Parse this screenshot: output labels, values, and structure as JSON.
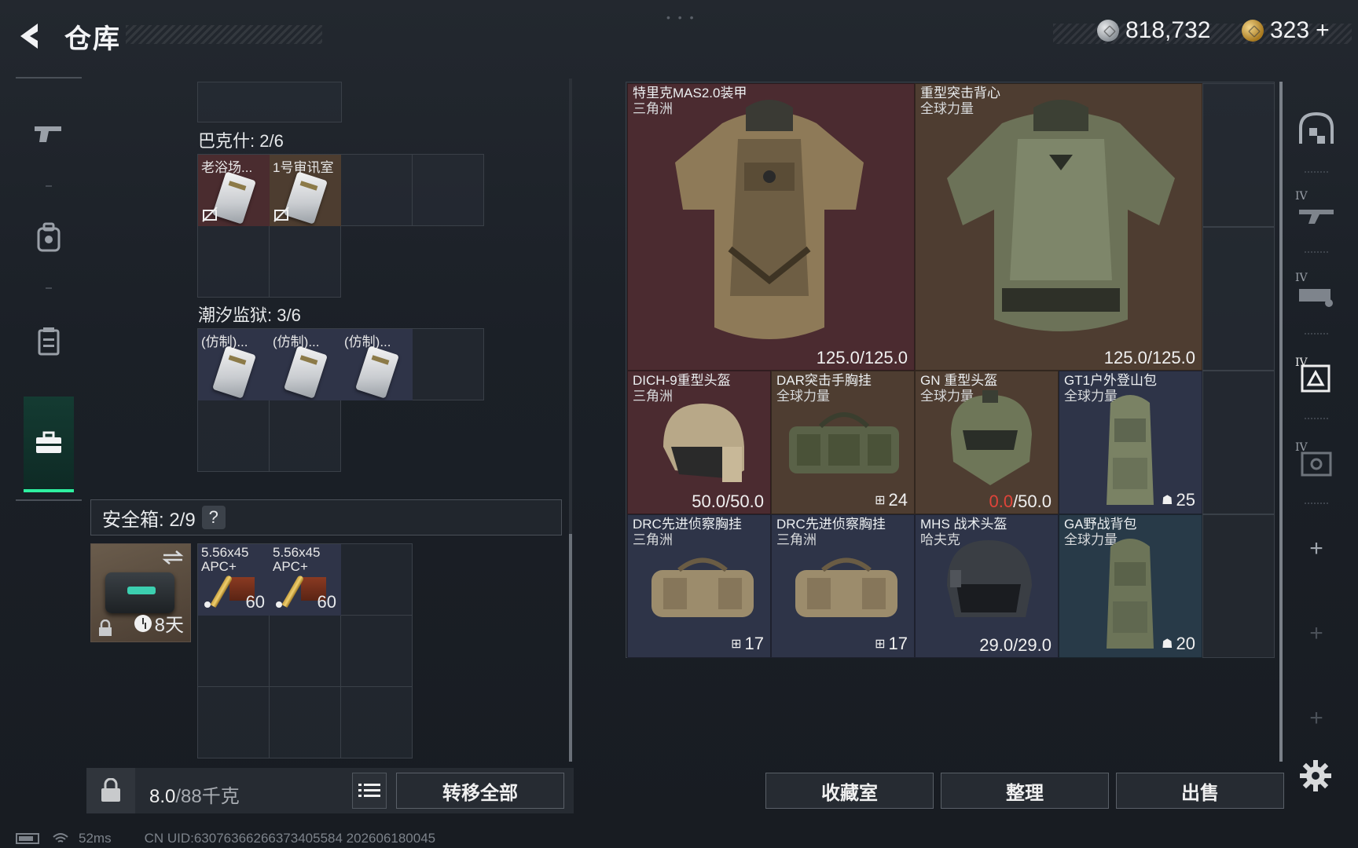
{
  "header": {
    "title": "仓库",
    "currency_silver": "818,732",
    "currency_gold": "323",
    "gold_plus": "+"
  },
  "left_nav": {
    "items": [
      {
        "name": "weapons",
        "icon": "pistol-icon"
      },
      {
        "name": "equipment",
        "icon": "backpack-icon"
      },
      {
        "name": "consumables",
        "icon": "container-icon"
      },
      {
        "name": "keys",
        "icon": "briefcase-icon",
        "active": true
      }
    ]
  },
  "key_groups": [
    {
      "label": "巴克什: 2/6",
      "items": [
        {
          "name": "老浴场..."
        },
        {
          "name": "1号审讯室"
        }
      ]
    },
    {
      "label": "潮汐监狱: 3/6",
      "items": [
        {
          "name": "(仿制)..."
        },
        {
          "name": "(仿制)..."
        },
        {
          "name": "(仿制)..."
        }
      ]
    }
  ],
  "safe_box": {
    "label": "安全箱: 2/9",
    "help": "?",
    "days": "8天",
    "ammo": [
      {
        "name": "5.56x45",
        "sub": "APC+",
        "count": "60"
      },
      {
        "name": "5.56x45",
        "sub": "APC+",
        "count": "60"
      }
    ]
  },
  "bottom_bar": {
    "weight_current": "8.0",
    "weight_max": "/88千克",
    "transfer_all": "转移全部"
  },
  "stash_items": [
    {
      "name": "特里克MAS2.0装甲",
      "origin": "三角洲",
      "durability": "125.0/125.0"
    },
    {
      "name": "重型突击背心",
      "origin": "全球力量",
      "durability": "125.0/125.0"
    },
    {
      "name": "DICH-9重型头盔",
      "origin": "三角洲",
      "durability": "50.0/50.0"
    },
    {
      "name": "DAR突击手胸挂",
      "origin": "全球力量",
      "capacity": "24"
    },
    {
      "name": "GN 重型头盔",
      "origin": "全球力量",
      "durability_current": "0.0",
      "durability_max": "/50.0"
    },
    {
      "name": "GT1户外登山包",
      "origin": "全球力量",
      "capacity": "25"
    },
    {
      "name": "DRC先进侦察胸挂",
      "origin": "三角洲",
      "capacity": "17"
    },
    {
      "name": "DRC先进侦察胸挂",
      "origin": "三角洲",
      "capacity": "17"
    },
    {
      "name": "MHS 战术头盔",
      "origin": "哈夫克",
      "durability": "29.0/29.0"
    },
    {
      "name": "GA野战背包",
      "origin": "全球力量",
      "capacity": "20"
    }
  ],
  "actions": {
    "collection": "收藏室",
    "sort": "整理",
    "sell": "出售"
  },
  "right_filters": {
    "level_label": "IV",
    "add": "+"
  },
  "status": {
    "ping": "52ms",
    "uid": "CN UID:630763662663734055​84 202606180045"
  },
  "colors": {
    "accent_green": "#2ef0a0",
    "broken_red": "#e0443a",
    "rarity_red": "#4b2b30",
    "rarity_blue": "#2e3448"
  }
}
